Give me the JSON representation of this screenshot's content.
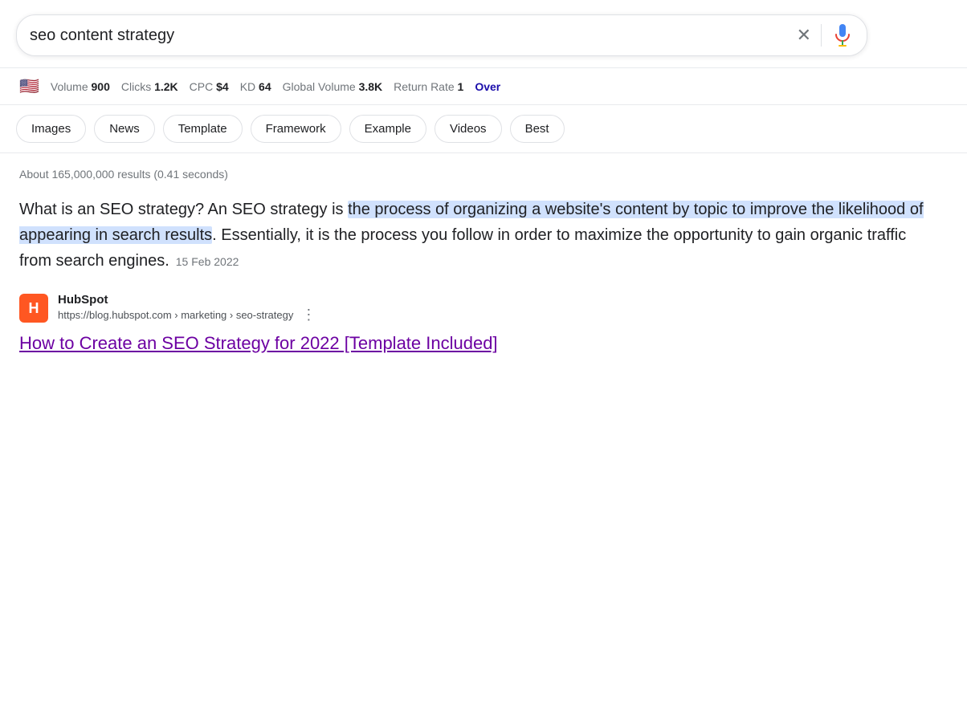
{
  "search": {
    "query": "seo content strategy",
    "clear_label": "×",
    "placeholder": "seo content strategy"
  },
  "metrics": {
    "flag": "🇺🇸",
    "items": [
      {
        "label": "Volume",
        "value": "900"
      },
      {
        "label": "Clicks",
        "value": "1.2K"
      },
      {
        "label": "CPC",
        "value": "$4"
      },
      {
        "label": "KD",
        "value": "64"
      },
      {
        "label": "Global Volume",
        "value": "3.8K"
      },
      {
        "label": "Return Rate",
        "value": "1"
      }
    ],
    "overflow_label": "Over"
  },
  "pills": [
    {
      "label": "Images"
    },
    {
      "label": "News"
    },
    {
      "label": "Template"
    },
    {
      "label": "Framework"
    },
    {
      "label": "Example"
    },
    {
      "label": "Videos"
    },
    {
      "label": "Best"
    }
  ],
  "results": {
    "count_text": "About 165,000,000 results (0.41 seconds)",
    "snippet": {
      "text_before": "What is an SEO strategy? An SEO strategy is ",
      "text_highlight": "the process of organizing a website's content by topic to improve the likelihood of appearing in search results",
      "text_after": ". Essentially, it is the process you follow in order to maximize the opportunity to gain organic traffic from search engines.",
      "date": "15 Feb 2022"
    },
    "source": {
      "name": "HubSpot",
      "logo_text": "H",
      "url": "https://blog.hubspot.com › marketing › seo-strategy"
    },
    "result_title": "How to Create an SEO Strategy for 2022 [Template Included]"
  }
}
